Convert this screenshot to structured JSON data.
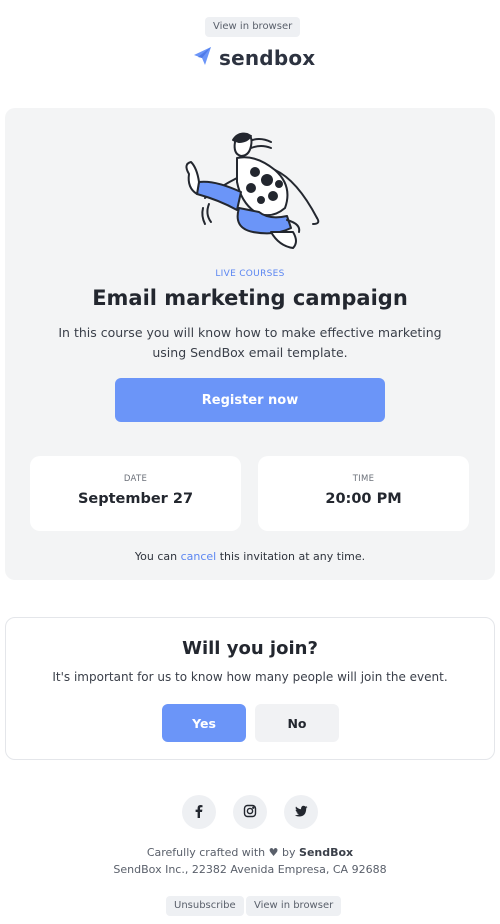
{
  "header": {
    "view_in_browser": "View in browser",
    "brand": "sendbox",
    "accent_color": "#6b95f8"
  },
  "course": {
    "eyebrow": "LIVE COURSES",
    "title": "Email marketing campaign",
    "description": "In this course you will know how to make effective marketing using SendBox email template.",
    "register_label": "Register now",
    "illustration": "jumping-person-illustration",
    "date_label": "DATE",
    "date_value": "September 27",
    "time_label": "TIME",
    "time_value": "20:00 PM",
    "cancel_prefix": "You can",
    "cancel_link": "cancel",
    "cancel_suffix": "this invitation at any time."
  },
  "join": {
    "title": "Will you join?",
    "description": "It's important for us to know how many people will join the event.",
    "yes_label": "Yes",
    "no_label": "No"
  },
  "social": [
    {
      "icon": "facebook-icon"
    },
    {
      "icon": "instagram-icon"
    },
    {
      "icon": "twitter-icon"
    }
  ],
  "footer": {
    "crafted_prefix": "Carefully crafted with",
    "crafted_by": "by",
    "crafted_brand": "SendBox",
    "address": "SendBox Inc., 22382 Avenida Empresa, CA 92688",
    "unsubscribe": "Unsubscribe",
    "view_in_browser": "View in browser"
  }
}
